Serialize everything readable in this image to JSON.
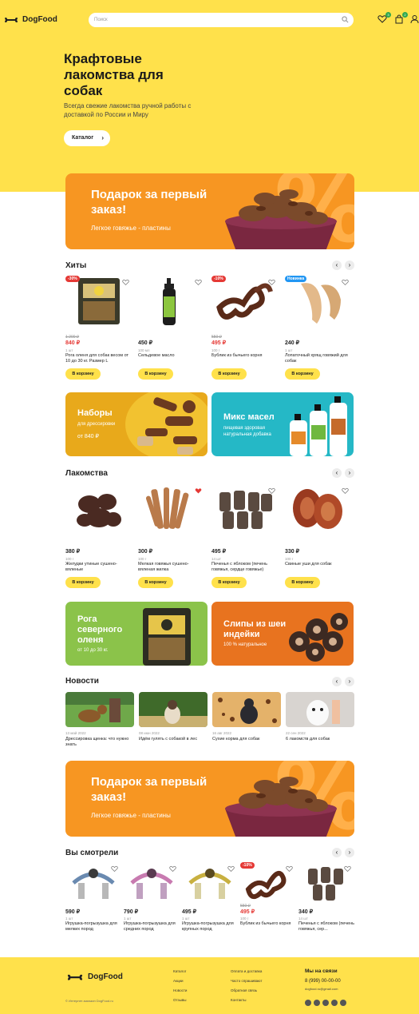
{
  "header": {
    "brand": "DogFood",
    "search_placeholder": "Поиск",
    "fav_count": "3",
    "cart_count": "2"
  },
  "hero": {
    "title": "Крафтовые лакомства для собак",
    "subtitle": "Всегда свежие лакомства ручной работы с доставкой по России и Миру",
    "catalog_btn": "Каталог"
  },
  "promo": {
    "title": "Подарок за первый заказ!",
    "subtitle": "Легкое говяжье - пластины",
    "deco": "%"
  },
  "hits": {
    "title": "Хиты",
    "items": [
      {
        "badge": "-30%",
        "old": "1 200 ₽",
        "price": "840 ₽",
        "unit": "1 шт",
        "name": "Рога оленя для собак весом от 10 до 30 кг. Размер L",
        "buy": "В корзину"
      },
      {
        "badge": "",
        "old": "",
        "price": "450 ₽",
        "unit": "100 мл",
        "name": "Сельдевое масло",
        "buy": "В корзину"
      },
      {
        "badge": "-10%",
        "old": "550 ₽",
        "price": "495 ₽",
        "unit": "100 г",
        "name": "Бублик из бычьего корня",
        "buy": "В корзину"
      },
      {
        "badge": "Новинка",
        "old": "",
        "price": "240 ₽",
        "unit": "1 шт",
        "name": "Лопаточный хрящ говяжий для собак",
        "buy": "В корзину"
      }
    ]
  },
  "banners1": [
    {
      "title": "Наборы",
      "sub": "для дрессировки",
      "extra": "от 840 ₽",
      "color": "#E8A91B"
    },
    {
      "title": "Микс масел",
      "sub": "пищевая здоровая натуральная добавка",
      "color": "#25B8C6"
    }
  ],
  "treats": {
    "title": "Лакомства",
    "items": [
      {
        "price": "380 ₽",
        "unit": "100 г",
        "name": "Желудки утиные сушено-вяленые",
        "buy": "В корзину"
      },
      {
        "price": "300 ₽",
        "unit": "100 г",
        "name": "Мелкая говяжья сушено-вяленая жилка",
        "buy": "В корзину"
      },
      {
        "price": "495 ₽",
        "unit": "14 шт",
        "name": "Печенья с яблоком (печень говяжья, сердце говяжье)",
        "buy": "В корзину"
      },
      {
        "price": "330 ₽",
        "unit": "100 г",
        "name": "Свиные уши для собак",
        "buy": "В корзину"
      }
    ]
  },
  "banners2": [
    {
      "title": "Рога северного оленя",
      "sub": "от 10 до 30 кг.",
      "color": "#8BC34A"
    },
    {
      "title": "Слипы из шеи индейки",
      "sub": "100 % натуральное",
      "color": "#E8731F"
    }
  ],
  "news": {
    "title": "Новости",
    "items": [
      {
        "date": "13 май 2022",
        "title": "Дрессировка щенка: что нужно знать"
      },
      {
        "date": "08 июн 2022",
        "title": "Идём гулять с собакой в лес"
      },
      {
        "date": "16 авг 2022",
        "title": "Сухие корма для собак"
      },
      {
        "date": "22 сен 2022",
        "title": "6 лакомств для собак"
      }
    ]
  },
  "viewed": {
    "title": "Вы смотрели",
    "items": [
      {
        "badge": "",
        "old": "",
        "price": "590 ₽",
        "unit": "1 шт",
        "name": "Игрушка-погрызушка для мелких пород"
      },
      {
        "badge": "",
        "old": "",
        "price": "790 ₽",
        "unit": "1 шт",
        "name": "Игрушка-погрызушка для средних пород"
      },
      {
        "badge": "",
        "old": "",
        "price": "495 ₽",
        "unit": "1 шт",
        "name": "Игрушка-погрызушка для крупных пород"
      },
      {
        "badge": "-10%",
        "old": "550 ₽",
        "price": "495 ₽",
        "unit": "100 г",
        "name": "Бублик из бычьего корня"
      },
      {
        "badge": "",
        "old": "",
        "price": "340 ₽",
        "unit": "14 шт",
        "name": "Печенья с яблоком (печень говяжья, сер..."
      }
    ]
  },
  "footer": {
    "brand": "DogFood",
    "copyright": "© Интернет-магазин DogFood.ru",
    "col1": [
      "Каталог",
      "Акции",
      "Новости",
      "Отзывы"
    ],
    "col2": [
      "Оплата и доставка",
      "Часто спрашивают",
      "Обратная связь",
      "Контакты"
    ],
    "contact_title": "Мы на связи",
    "phone": "8 (999) 00-00-00",
    "email": "dogfood.ru@gmail.com"
  }
}
